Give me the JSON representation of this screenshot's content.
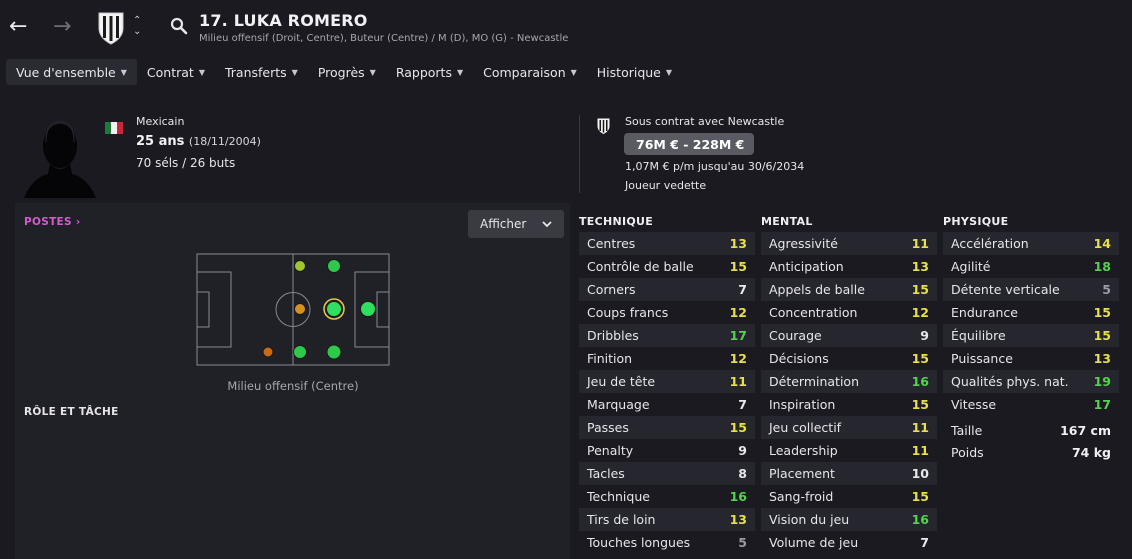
{
  "header": {
    "title": "17. LUKA ROMERO",
    "subtitle": "Milieu offensif (Droit, Centre), Buteur (Centre) / M (D), MO (G) - Newcastle"
  },
  "tabs": [
    {
      "label": "Vue d'ensemble",
      "active": true
    },
    {
      "label": "Contrat"
    },
    {
      "label": "Transferts"
    },
    {
      "label": "Progrès"
    },
    {
      "label": "Rapports"
    },
    {
      "label": "Comparaison"
    },
    {
      "label": "Historique"
    }
  ],
  "profile": {
    "nationality": "Mexicain",
    "age": "25 ans",
    "dob": "(18/11/2004)",
    "caps": "70 séls / 26 buts",
    "flag_colors": [
      "#1f7a3a",
      "#f2f2f2",
      "#c8283a"
    ]
  },
  "contract": {
    "club_label": "Sous contrat avec Newcastle",
    "value": "76M € - 228M €",
    "wage": "1,07M € p/m jusqu'au 30/6/2034",
    "status": "Joueur vedette"
  },
  "left_panel": {
    "postes_label": "POSTES",
    "afficher_label": "Afficher",
    "position_caption": "Milieu offensif (Centre)",
    "role_title": "RÔLE ET TÂCHE"
  },
  "positions": [
    {
      "name": "M-Droit",
      "level": "competent",
      "color": "#9fc62e"
    },
    {
      "name": "MO-Droit",
      "level": "accomplished",
      "color": "#2ec84a"
    },
    {
      "name": "M-Centre",
      "level": "unconvincing",
      "color": "#d6921e"
    },
    {
      "name": "MO-Centre",
      "level": "natural",
      "color": "#2ee060"
    },
    {
      "name": "Buteur-Centre",
      "level": "natural",
      "color": "#2ee060"
    },
    {
      "name": "DM-Gauche",
      "level": "awkward",
      "color": "#c86a18"
    },
    {
      "name": "M-Gauche",
      "level": "accomplished",
      "color": "#2ec84a"
    },
    {
      "name": "MO-Gauche",
      "level": "accomplished",
      "color": "#2ec84a"
    }
  ],
  "attributes": {
    "technique": {
      "title": "TECHNIQUE",
      "items": [
        {
          "name": "Centres",
          "value": 13
        },
        {
          "name": "Contrôle de balle",
          "value": 15
        },
        {
          "name": "Corners",
          "value": 7
        },
        {
          "name": "Coups francs",
          "value": 12
        },
        {
          "name": "Dribbles",
          "value": 17
        },
        {
          "name": "Finition",
          "value": 12
        },
        {
          "name": "Jeu de tête",
          "value": 11
        },
        {
          "name": "Marquage",
          "value": 7
        },
        {
          "name": "Passes",
          "value": 15
        },
        {
          "name": "Penalty",
          "value": 9
        },
        {
          "name": "Tacles",
          "value": 8
        },
        {
          "name": "Technique",
          "value": 16
        },
        {
          "name": "Tirs de loin",
          "value": 13
        },
        {
          "name": "Touches longues",
          "value": 5
        }
      ]
    },
    "mental": {
      "title": "MENTAL",
      "items": [
        {
          "name": "Agressivité",
          "value": 11
        },
        {
          "name": "Anticipation",
          "value": 13
        },
        {
          "name": "Appels de balle",
          "value": 15
        },
        {
          "name": "Concentration",
          "value": 12
        },
        {
          "name": "Courage",
          "value": 9
        },
        {
          "name": "Décisions",
          "value": 15
        },
        {
          "name": "Détermination",
          "value": 16
        },
        {
          "name": "Inspiration",
          "value": 15
        },
        {
          "name": "Jeu collectif",
          "value": 11
        },
        {
          "name": "Leadership",
          "value": 11
        },
        {
          "name": "Placement",
          "value": 10
        },
        {
          "name": "Sang-froid",
          "value": 15
        },
        {
          "name": "Vision du jeu",
          "value": 16
        },
        {
          "name": "Volume de jeu",
          "value": 7
        }
      ]
    },
    "physique": {
      "title": "PHYSIQUE",
      "items": [
        {
          "name": "Accélération",
          "value": 14
        },
        {
          "name": "Agilité",
          "value": 18
        },
        {
          "name": "Détente verticale",
          "value": 5
        },
        {
          "name": "Endurance",
          "value": 15
        },
        {
          "name": "Équilibre",
          "value": 15
        },
        {
          "name": "Puissance",
          "value": 13
        },
        {
          "name": "Qualités phys. nat.",
          "value": 19
        },
        {
          "name": "Vitesse",
          "value": 17
        }
      ],
      "extra": [
        {
          "name": "Taille",
          "value": "167 cm"
        },
        {
          "name": "Poids",
          "value": "74 kg"
        }
      ]
    }
  },
  "colors": {
    "background": "#1a1a20",
    "panel": "#202027",
    "accent_link": "#d25cd0",
    "value_low": "#9c9ca4",
    "value_mid": "#e8e8ec",
    "value_good": "#e8e04a",
    "value_high": "#54d44c"
  },
  "icons": [
    "back-arrow-icon",
    "forward-arrow-icon",
    "club-badge-icon",
    "updown-chevron-icon",
    "search-icon",
    "chevron-down-icon",
    "player-silhouette-icon",
    "flag-icon"
  ]
}
